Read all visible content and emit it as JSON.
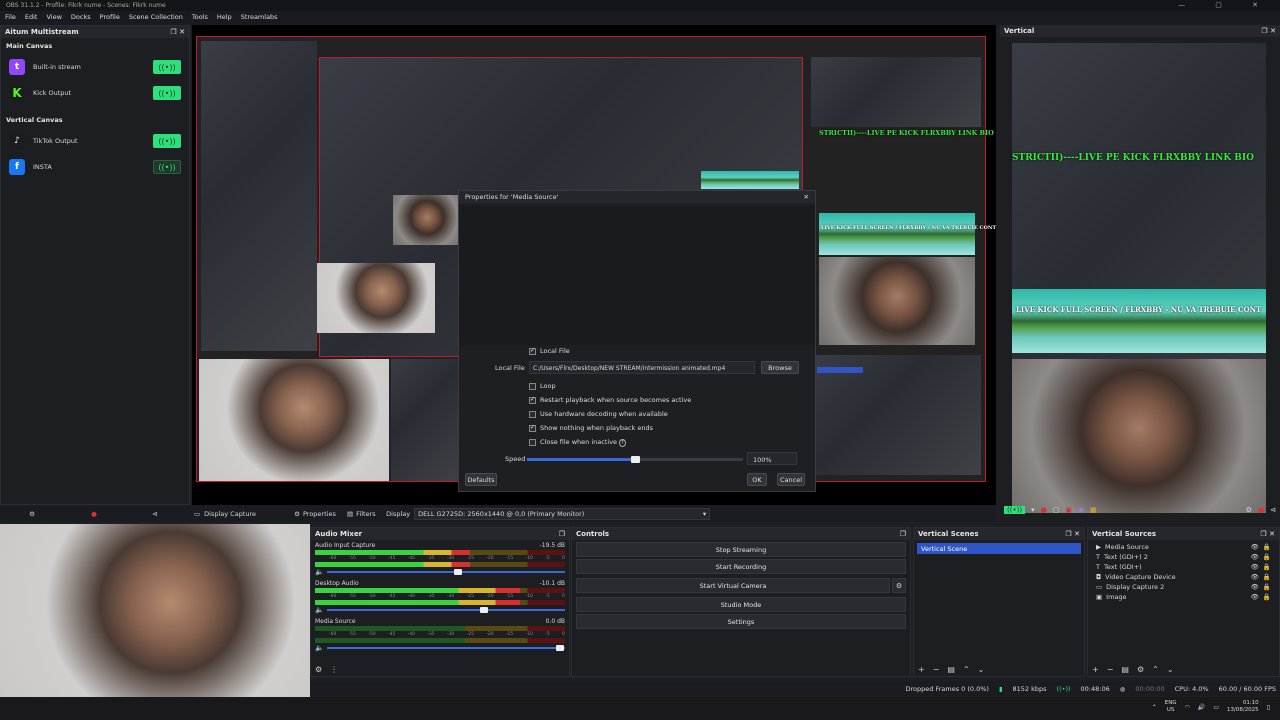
{
  "titlebar": {
    "title": "OBS 31.1.2 - Profile: Fikrk nume - Scenes: Fikrk nume",
    "controls": "— ▢ ✕"
  },
  "menu": [
    "File",
    "Edit",
    "View",
    "Docks",
    "Profile",
    "Scene Collection",
    "Tools",
    "Help",
    "Streamlabs"
  ],
  "multistream": {
    "title": "Aitum Multistream",
    "main_canvas": "Main Canvas",
    "vertical_canvas": "Vertical Canvas",
    "outputs": [
      {
        "label": "Built-in stream",
        "icon": "twitch-icon",
        "glyph": "t",
        "color": "#9146ff",
        "active": true
      },
      {
        "label": "Kick Output",
        "icon": "kick-icon",
        "glyph": "K",
        "color": "#1b1c20",
        "active": true
      },
      {
        "label": "TikTok Output",
        "icon": "tiktok-icon",
        "glyph": "♪",
        "color": "#1b1c20",
        "active": true
      },
      {
        "label": "INSTA",
        "icon": "facebook-icon",
        "glyph": "f",
        "color": "#1877f2",
        "active": false
      }
    ]
  },
  "overlay_text": {
    "top": "STRICTII)----LIVE PE KICK   FLRXBBY LINK BIO",
    "bottom": "LIVE KICK FULL SCREEN  /  FLRXBBY - NU VA TREBUIE CONT"
  },
  "dialog": {
    "title": "Properties for 'Media Source'",
    "local_file_check": "Local File",
    "local_file_label": "Local File",
    "local_file_value": "C:/Users/Flrx/Desktop/NEW STREAM/intermission animated.mp4",
    "browse": "Browse",
    "loop": "Loop",
    "restart": "Restart playback when source becomes active",
    "hw": "Use hardware decoding when available",
    "show_nothing": "Show nothing when playback ends",
    "close_inactive": "Close file when inactive",
    "speed_label": "Speed",
    "speed_value": "100%",
    "speed_fraction": 0.5,
    "defaults": "Defaults",
    "ok": "OK",
    "cancel": "Cancel"
  },
  "toolbar": {
    "source_name": "Display Capture",
    "properties": "Properties",
    "filters": "Filters",
    "display_label": "Display",
    "display_value": "DELL G2725D: 2560x1440 @ 0,0 (Primary Monitor)"
  },
  "vertical": {
    "title": "Vertical"
  },
  "mixer": {
    "title": "Audio Mixer",
    "channels": [
      {
        "name": "Audio Input Capture",
        "db": "-19.5 dB",
        "level": 0.62,
        "vol": 0.55
      },
      {
        "name": "Desktop Audio",
        "db": "-10.1 dB",
        "level": 0.82,
        "vol": 0.66
      },
      {
        "name": "Media Source",
        "db": "0.0 dB",
        "level": 0.0,
        "vol": 0.98
      }
    ],
    "scale": [
      "-60",
      "-55",
      "-50",
      "-45",
      "-40",
      "-35",
      "-30",
      "-25",
      "-20",
      "-15",
      "-10",
      "-5",
      "0"
    ]
  },
  "controls": {
    "title": "Controls",
    "stop_streaming": "Stop Streaming",
    "start_recording": "Start Recording",
    "start_virtual_camera": "Start Virtual Camera",
    "studio_mode": "Studio Mode",
    "settings": "Settings"
  },
  "vertical_scenes": {
    "title": "Vertical Scenes",
    "items": [
      "Vertical Scene"
    ]
  },
  "vertical_sources": {
    "title": "Vertical Sources",
    "items": [
      "Media Source",
      "Text (GDI+) 2",
      "Text (GDI+)",
      "Video Capture Device",
      "Display Capture 2",
      "Image"
    ]
  },
  "status": {
    "dropped": "Dropped Frames 0 (0.0%)",
    "bitrate": "8152 kbps",
    "stream_time": "00:48:06",
    "rec_time": "00:00:00",
    "cpu": "CPU: 4.0%",
    "fps": "60.00 / 60.00 FPS"
  },
  "taskbar": {
    "lang": "ENG",
    "region": "US",
    "time": "01:10",
    "date": "13/08/2025"
  },
  "colors": {
    "accent_green": "#2ee07c",
    "preview_border": "#c21d2b",
    "selection": "#2f55c9"
  }
}
